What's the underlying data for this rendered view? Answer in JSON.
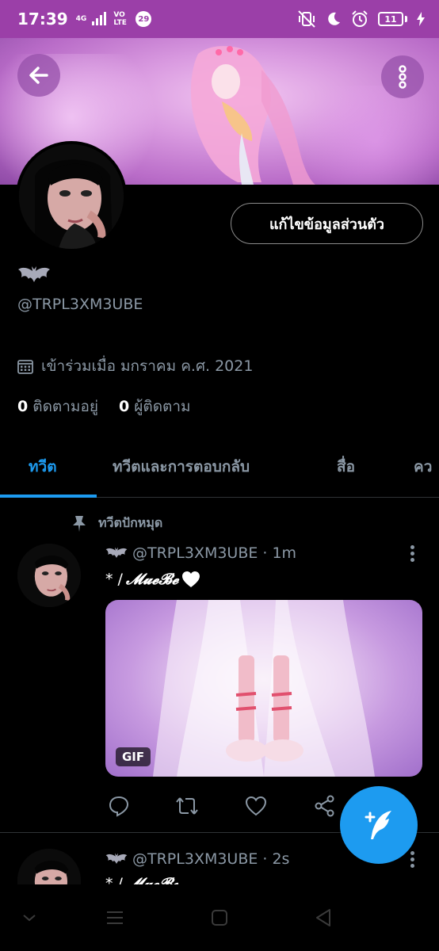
{
  "status_bar": {
    "time": "17:39",
    "network_top": "4G",
    "network_volte": "VO LTE",
    "notification_count": "29",
    "battery": "11"
  },
  "profile": {
    "edit_button": "แก้ไขข้อมูลส่วนตัว",
    "handle": "@TRPL3XM3UBE",
    "joined": "เข้าร่วมเมื่อ มกราคม ค.ศ. 2021",
    "following_count": "0",
    "following_label": "ติดตามอยู่",
    "followers_count": "0",
    "followers_label": "ผู้ติดตาม"
  },
  "tabs": [
    {
      "label": "ทวีต",
      "active": true
    },
    {
      "label": "ทวีตและการตอบกลับ",
      "active": false
    },
    {
      "label": "สื่อ",
      "active": false
    },
    {
      "label": "คว",
      "active": false
    }
  ],
  "tweets": [
    {
      "pinned_label": "ทวีตปักหมุด",
      "handle": "@TRPL3XM3UBE",
      "dot": "·",
      "time": "1m",
      "text_prefix": "* /",
      "text_fancy": "𝓜𝓾𝓮𝓑𝓮",
      "media_badge": "GIF"
    },
    {
      "handle": "@TRPL3XM3UBE",
      "dot": "·",
      "time": "2s",
      "text_prefix": "* /",
      "text_fancy": "𝓜𝓾𝓮𝓑𝓮"
    }
  ],
  "colors": {
    "accent": "#1d9bf0",
    "status_bar": "#9b3fa8",
    "muted_text": "#8b98a5"
  }
}
